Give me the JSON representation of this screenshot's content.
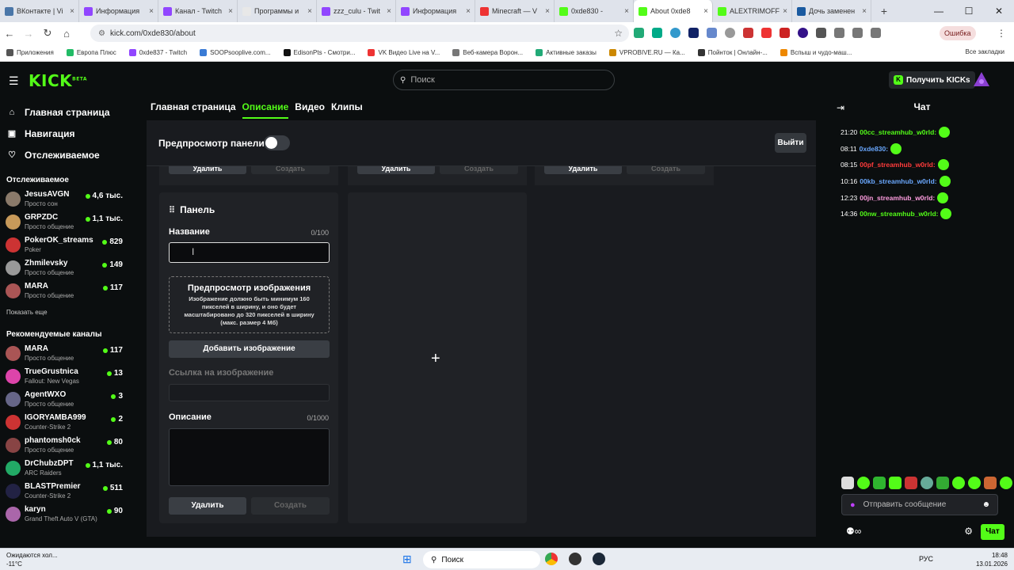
{
  "browser": {
    "tabs": [
      {
        "title": "ВКонтакте | Vi",
        "color": "#4a76a8"
      },
      {
        "title": "Информация",
        "color": "#9146ff"
      },
      {
        "title": "Канал - Twitch",
        "color": "#9146ff"
      },
      {
        "title": "Программы и",
        "color": "#e8e8e8"
      },
      {
        "title": "zzz_culu - Twit",
        "color": "#9146ff"
      },
      {
        "title": "Информация",
        "color": "#9146ff"
      },
      {
        "title": "Minecraft — V",
        "color": "#e33"
      },
      {
        "title": "0xde830 - ",
        "color": "#53fc18"
      },
      {
        "title": "About 0xde8",
        "color": "#53fc18",
        "active": true
      },
      {
        "title": "ALEXTRIMOFF",
        "color": "#53fc18"
      },
      {
        "title": "Дочь заменен",
        "color": "#1a5aa0"
      }
    ],
    "url": "kick.com/0xde830/about",
    "error_label": "Ошибка",
    "bookmarks": [
      {
        "label": "Приложения",
        "color": "#555"
      },
      {
        "label": "Европа Плюс",
        "color": "#2b6"
      },
      {
        "label": "0xde837 - Twitch",
        "color": "#9146ff"
      },
      {
        "label": "SOOPsooplive.com...",
        "color": "#3a7bd5"
      },
      {
        "label": "EdisonPts - Смотри...",
        "color": "#111"
      },
      {
        "label": "VK Видео Live на V...",
        "color": "#e33"
      },
      {
        "label": "Веб-камера Ворон...",
        "color": "#777"
      },
      {
        "label": "Активные заказы",
        "color": "#2a7"
      },
      {
        "label": "VPROBIVE.RU — Ка...",
        "color": "#c80"
      },
      {
        "label": "Пойнток | Онлайн-...",
        "color": "#333"
      },
      {
        "label": "Вспыш и чудо-маш...",
        "color": "#e80"
      }
    ],
    "all_bookmarks": "Все закладки"
  },
  "header": {
    "logo": "KICK",
    "logo_sup": "BETA",
    "search_placeholder": "Поиск",
    "get_kicks": "Получить KICKs"
  },
  "sidebar": {
    "nav": [
      {
        "label": "Главная страница",
        "icon": "⌂"
      },
      {
        "label": "Навигация",
        "icon": "▣"
      },
      {
        "label": "Отслеживаемое",
        "icon": "♡"
      }
    ],
    "followed_title": "Отслеживаемое",
    "followed": [
      {
        "name": "JesusAVGN",
        "sub": "Просто сон",
        "viewers": "4,6 тыс.",
        "color": "#8a7a6a"
      },
      {
        "name": "GRPZDC",
        "sub": "Просто общение",
        "viewers": "1,1 тыс.",
        "color": "#c79a5a"
      },
      {
        "name": "PokerOK_streams",
        "sub": "Poker",
        "viewers": "829",
        "color": "#c33"
      },
      {
        "name": "Zhmilevsky",
        "sub": "Просто общение",
        "viewers": "149",
        "color": "#999"
      },
      {
        "name": "MARA",
        "sub": "Просто общение",
        "viewers": "117",
        "color": "#a55"
      }
    ],
    "show_more": "Показать еще",
    "recommended_title": "Рекомендуемые каналы",
    "recommended": [
      {
        "name": "MARA",
        "sub": "Просто общение",
        "viewers": "117",
        "color": "#a55"
      },
      {
        "name": "TrueGrustnica",
        "sub": "Fallout: New Vegas",
        "viewers": "13",
        "color": "#d4a"
      },
      {
        "name": "AgentWXO",
        "sub": "Просто общение",
        "viewers": "3",
        "color": "#668"
      },
      {
        "name": "IGORYAMBA999",
        "sub": "Counter-Strike 2",
        "viewers": "2",
        "color": "#c33"
      },
      {
        "name": "phantomsh0ck",
        "sub": "Просто общение",
        "viewers": "80",
        "color": "#844"
      },
      {
        "name": "DrChubzDPT",
        "sub": "ARC Raiders",
        "viewers": "1,1 тыс.",
        "color": "#2a6"
      },
      {
        "name": "BLASTPremier",
        "sub": "Counter-Strike 2",
        "viewers": "511",
        "color": "#224"
      },
      {
        "name": "karyn",
        "sub": "Grand Theft Auto V (GTA)",
        "viewers": "90",
        "color": "#a6a"
      }
    ]
  },
  "main": {
    "tabs": [
      {
        "label": "Главная страница",
        "active": false
      },
      {
        "label": "Описание",
        "active": true
      },
      {
        "label": "Видео",
        "active": false
      },
      {
        "label": "Клипы",
        "active": false
      }
    ],
    "preview_label": "Предпросмотр панели",
    "exit_label": "Выйти",
    "stub_delete": "Удалить",
    "stub_create": "Создать",
    "panel": {
      "title": "Панель",
      "name_label": "Название",
      "name_count": "0/100",
      "image_preview_title": "Предпросмотр изображения",
      "image_preview_desc": "Изображение должно быть минимум 160 пикселей в ширину, и оно будет масштабировано до 320 пикселей в ширину (макс. размер 4 Мб)",
      "add_image": "Добавить изображение",
      "link_label": "Ссылка на изображение",
      "desc_label": "Описание",
      "desc_count": "0/1000",
      "delete": "Удалить",
      "create": "Создать"
    },
    "add_panel_icon": "+"
  },
  "chat": {
    "title": "Чат",
    "messages": [
      {
        "time": "21:20",
        "user": "00cc_streamhub_w0rld:",
        "color": "#53fc18"
      },
      {
        "time": "08:11",
        "user": "0xde830:",
        "color": "#6aa8ff"
      },
      {
        "time": "08:15",
        "user": "00pf_streamhub_w0rld:",
        "color": "#ff3b3b"
      },
      {
        "time": "10:16",
        "user": "00kb_streamhub_w0rld:",
        "color": "#6aa8ff"
      },
      {
        "time": "12:23",
        "user": "00jn_streamhub_w0rld:",
        "color": "#ff9de0"
      },
      {
        "time": "14:36",
        "user": "00nw_streamhub_w0rld:",
        "color": "#53fc18"
      }
    ],
    "input_placeholder": "Отправить сообщение",
    "send_label": "Чат"
  },
  "taskbar": {
    "weather_line1": "Ожидаются хол...",
    "weather_line2": "-11°C",
    "search": "Поиск",
    "lang": "РУС",
    "time": "18:48",
    "date": "13.01.2026"
  }
}
